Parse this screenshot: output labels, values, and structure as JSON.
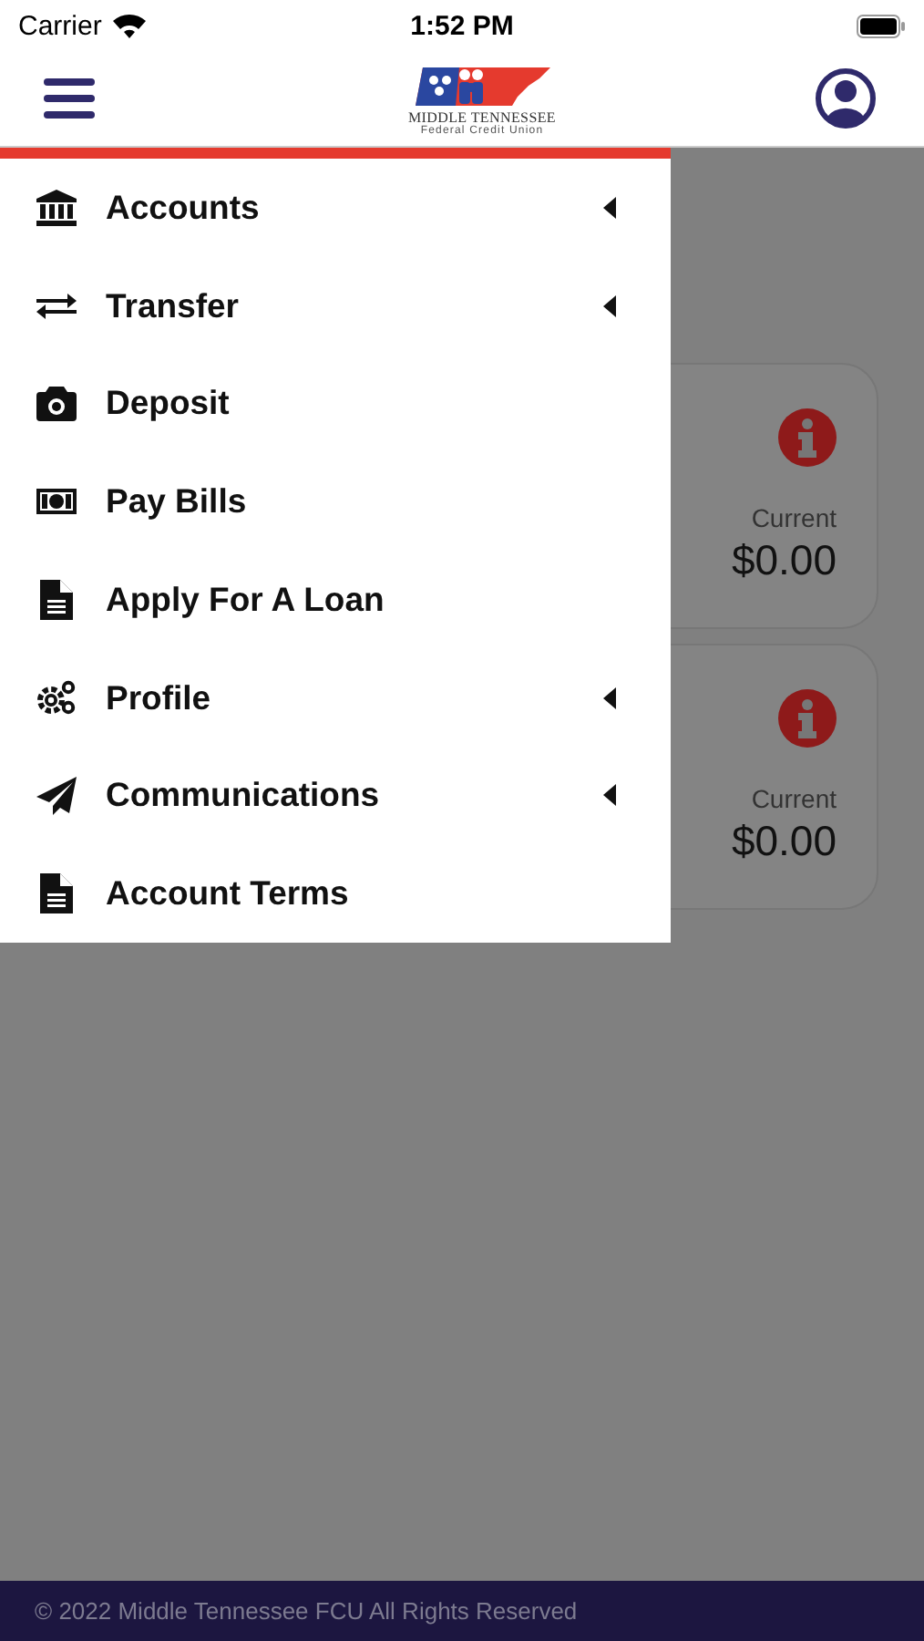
{
  "status_bar": {
    "carrier": "Carrier",
    "time": "1:52 PM"
  },
  "header": {
    "logo_name": "MIDDLE TENNESSEE",
    "logo_sub": "Federal Credit Union"
  },
  "menu": {
    "items": [
      {
        "label": "Accounts",
        "has_submenu": true
      },
      {
        "label": "Transfer",
        "has_submenu": true
      },
      {
        "label": "Deposit",
        "has_submenu": false
      },
      {
        "label": "Pay Bills",
        "has_submenu": false
      },
      {
        "label": "Apply For A Loan",
        "has_submenu": false
      },
      {
        "label": "Profile",
        "has_submenu": true
      },
      {
        "label": "Communications",
        "has_submenu": true
      },
      {
        "label": "Account Terms",
        "has_submenu": false
      }
    ]
  },
  "cards": [
    {
      "label": "Current",
      "amount": "$0.00"
    },
    {
      "label": "Current",
      "amount": "$0.00"
    }
  ],
  "footer": "© 2022 Middle Tennessee FCU All Rights Reserved"
}
